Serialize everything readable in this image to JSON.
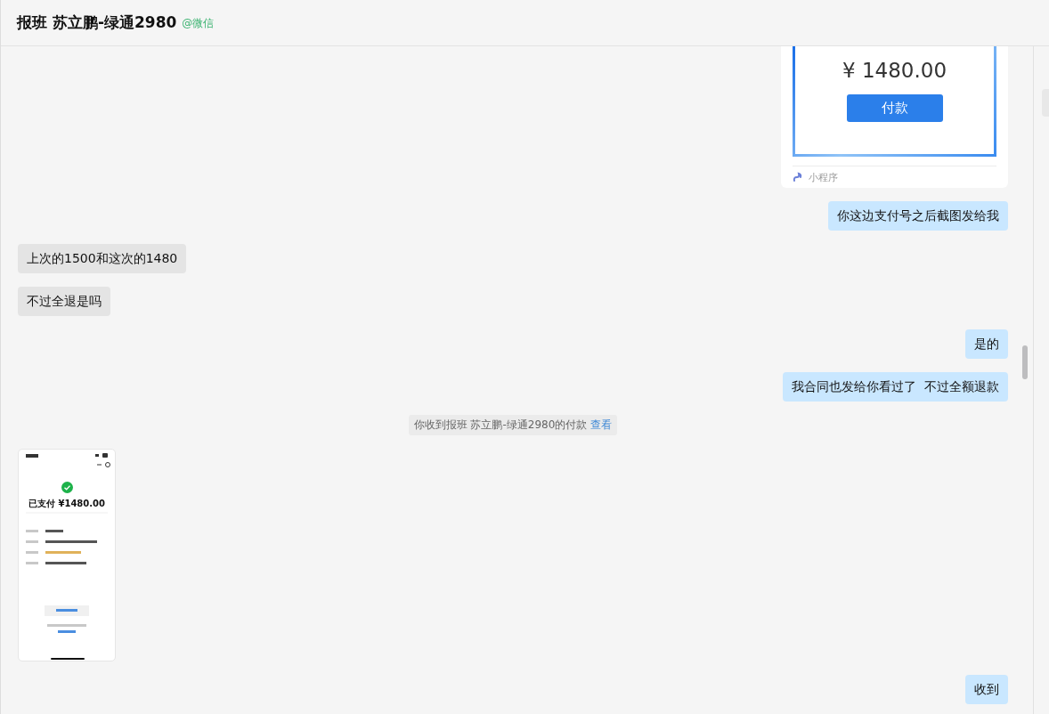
{
  "header": {
    "title": "报班 苏立鹏-绿通2980",
    "source": "@微信"
  },
  "messages": [
    {
      "kind": "miniprogram",
      "amount": "¥ 1480.00",
      "button": "付款",
      "footer": "小程序"
    },
    {
      "kind": "text",
      "outgoing": true,
      "text": "你这边支付号之后截图发给我"
    },
    {
      "kind": "text",
      "outgoing": false,
      "text": "上次的1500和这次的1480"
    },
    {
      "kind": "text",
      "outgoing": false,
      "text": "不过全退是吗"
    },
    {
      "kind": "text",
      "outgoing": true,
      "text": "是的"
    },
    {
      "kind": "text",
      "outgoing": true,
      "text": "我合同也发给你看过了  不过全额退款"
    },
    {
      "kind": "system",
      "text": "你收到报班 苏立鹏-绿通2980的付款",
      "link": "查看"
    },
    {
      "kind": "screenshot",
      "status": "已支付 ¥1480.00"
    },
    {
      "kind": "text",
      "outgoing": true,
      "text": "收到"
    }
  ]
}
